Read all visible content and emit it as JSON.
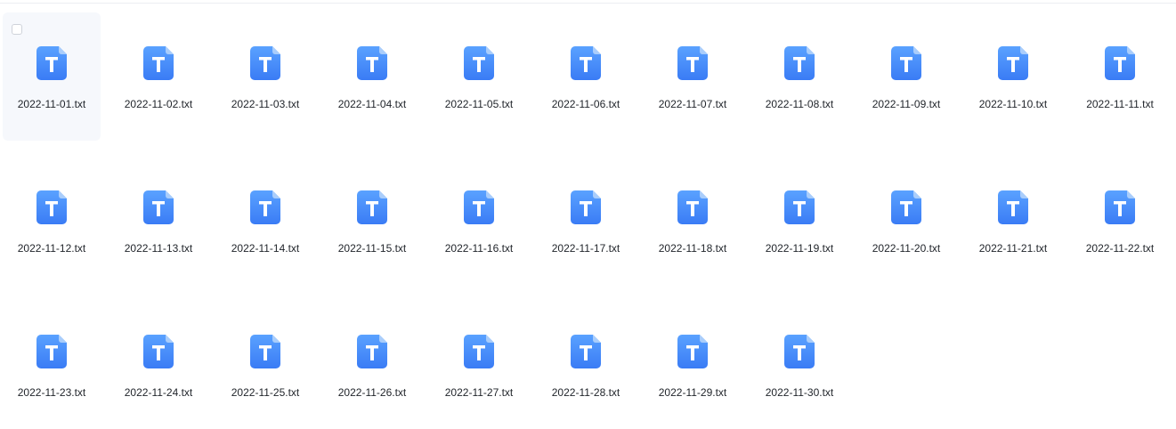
{
  "icon": "txt-file-icon",
  "colors": {
    "icon_top": "#5aa2ff",
    "icon_bottom": "#3a7cf5",
    "icon_fold": "#a9cdfb",
    "hover_bg": "#f6f8fc",
    "text": "#1f2329"
  },
  "hovered_index": 0,
  "files": [
    {
      "name": "2022-11-01.txt"
    },
    {
      "name": "2022-11-02.txt"
    },
    {
      "name": "2022-11-03.txt"
    },
    {
      "name": "2022-11-04.txt"
    },
    {
      "name": "2022-11-05.txt"
    },
    {
      "name": "2022-11-06.txt"
    },
    {
      "name": "2022-11-07.txt"
    },
    {
      "name": "2022-11-08.txt"
    },
    {
      "name": "2022-11-09.txt"
    },
    {
      "name": "2022-11-10.txt"
    },
    {
      "name": "2022-11-11.txt"
    },
    {
      "name": "2022-11-12.txt"
    },
    {
      "name": "2022-11-13.txt"
    },
    {
      "name": "2022-11-14.txt"
    },
    {
      "name": "2022-11-15.txt"
    },
    {
      "name": "2022-11-16.txt"
    },
    {
      "name": "2022-11-17.txt"
    },
    {
      "name": "2022-11-18.txt"
    },
    {
      "name": "2022-11-19.txt"
    },
    {
      "name": "2022-11-20.txt"
    },
    {
      "name": "2022-11-21.txt"
    },
    {
      "name": "2022-11-22.txt"
    },
    {
      "name": "2022-11-23.txt"
    },
    {
      "name": "2022-11-24.txt"
    },
    {
      "name": "2022-11-25.txt"
    },
    {
      "name": "2022-11-26.txt"
    },
    {
      "name": "2022-11-27.txt"
    },
    {
      "name": "2022-11-28.txt"
    },
    {
      "name": "2022-11-29.txt"
    },
    {
      "name": "2022-11-30.txt"
    }
  ]
}
